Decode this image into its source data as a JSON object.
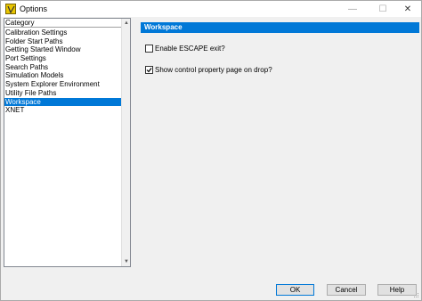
{
  "window": {
    "title": "Options",
    "minimize_glyph": "—",
    "maximize_glyph": "☐",
    "close_glyph": "✕"
  },
  "category": {
    "header": "Category",
    "items": [
      {
        "label": "Calibration Settings",
        "selected": false
      },
      {
        "label": "Folder Start Paths",
        "selected": false
      },
      {
        "label": "Getting Started Window",
        "selected": false
      },
      {
        "label": "Port Settings",
        "selected": false
      },
      {
        "label": "Search Paths",
        "selected": false
      },
      {
        "label": "Simulation Models",
        "selected": false
      },
      {
        "label": "System Explorer Environment",
        "selected": false
      },
      {
        "label": "Utility File Paths",
        "selected": false
      },
      {
        "label": "Workspace",
        "selected": true
      },
      {
        "label": "XNET",
        "selected": false
      }
    ],
    "scroll_up_glyph": "▲",
    "scroll_down_glyph": "▼"
  },
  "workspace": {
    "header": "Workspace",
    "options": [
      {
        "label": "Enable ESCAPE exit?",
        "checked": false
      },
      {
        "label": "Show control property page on drop?",
        "checked": true
      }
    ]
  },
  "buttons": {
    "ok": "OK",
    "cancel": "Cancel",
    "help": "Help"
  },
  "colors": {
    "accent": "#0078d7",
    "panel_bg": "#f0f0f0",
    "app_icon": "#e8c500"
  },
  "icons": {
    "app": "labview-app-icon",
    "check": "checkmark-icon"
  }
}
